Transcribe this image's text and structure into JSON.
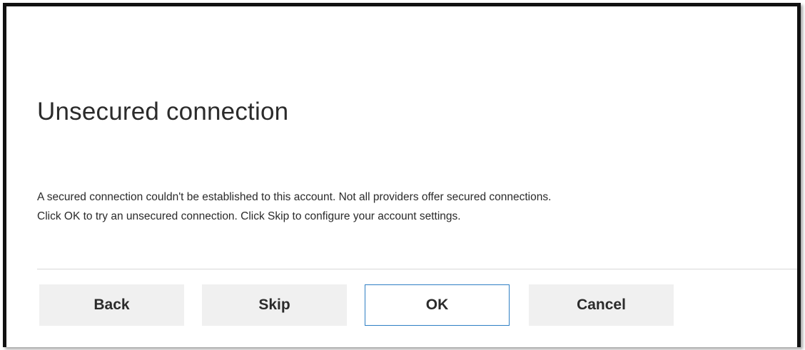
{
  "dialog": {
    "title": "Unsecured connection",
    "message_line1": "A secured connection couldn't be established to this account. Not all providers offer secured connections.",
    "message_line2": "Click OK to try an unsecured connection. Click Skip to configure your account settings."
  },
  "buttons": {
    "back_label": "Back",
    "skip_label": "Skip",
    "ok_label": "OK",
    "cancel_label": "Cancel"
  },
  "colors": {
    "primary_button_border": "#2e7fc4",
    "button_background": "#f0f0f0",
    "frame_border": "#111111"
  }
}
